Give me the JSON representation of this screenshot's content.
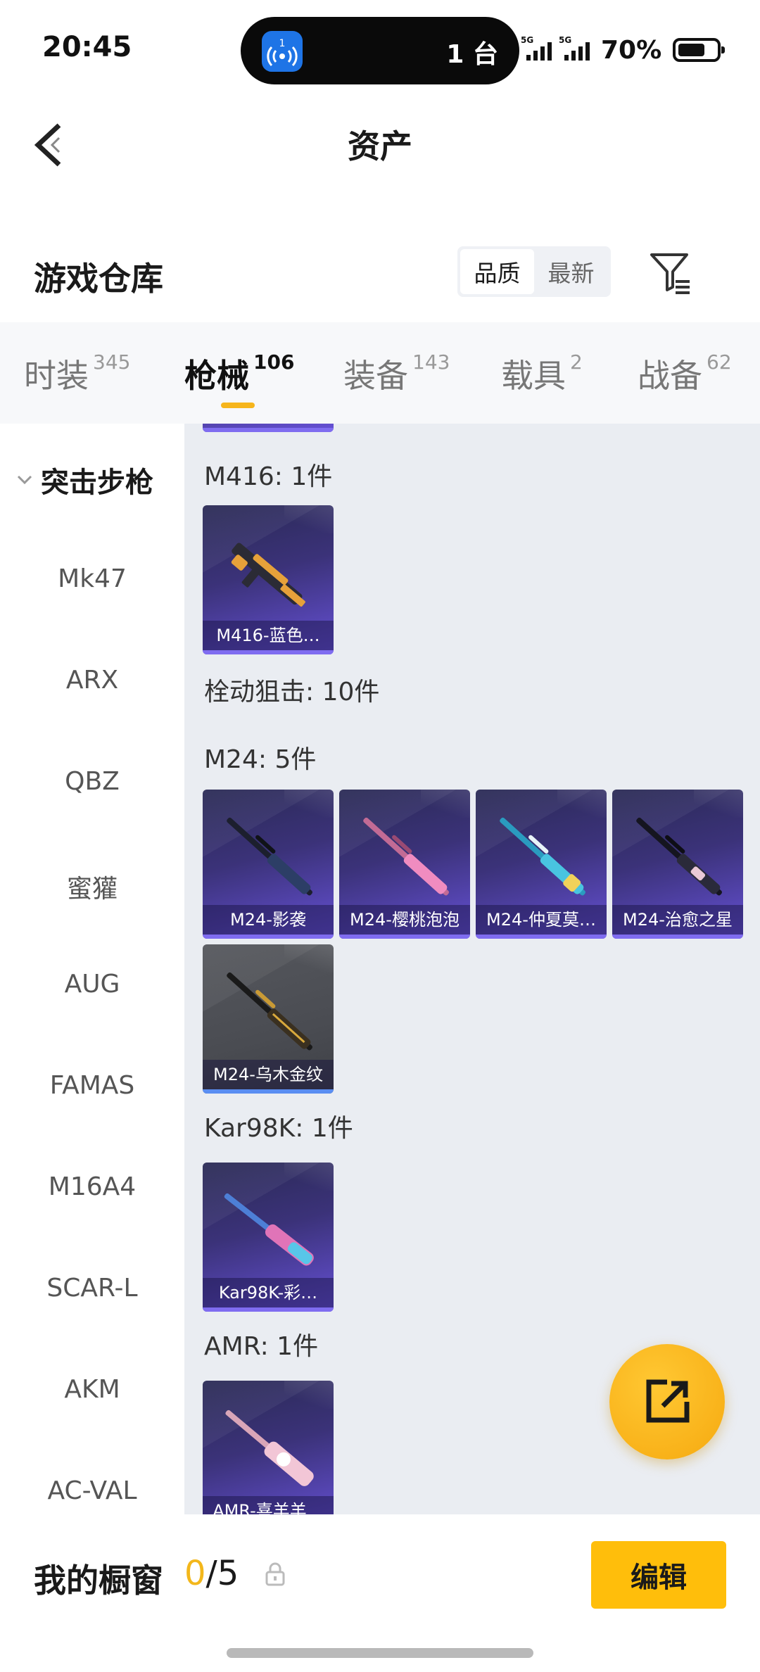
{
  "status": {
    "time": "20:45",
    "island_text": "1 台",
    "island_badge": "1",
    "sim1": "5G",
    "sim2": "5G",
    "battery_pct": "70%",
    "battery_level": 0.7
  },
  "nav": {
    "title": "资产"
  },
  "warehouse": {
    "title": "游戏仓库",
    "sort_options": [
      "品质",
      "最新"
    ],
    "sort_selected": "品质"
  },
  "tabs": [
    {
      "label": "时装",
      "count": "345"
    },
    {
      "label": "枪械",
      "count": "106",
      "active": true
    },
    {
      "label": "装备",
      "count": "143"
    },
    {
      "label": "载具",
      "count": "2"
    },
    {
      "label": "战备",
      "count": "62"
    }
  ],
  "sidebar": {
    "group": "突击步枪",
    "items": [
      "Mk47",
      "ARX",
      "QBZ",
      "蜜獾",
      "AUG",
      "FAMAS",
      "M16A4",
      "SCAR-L",
      "AKM",
      "AC-VAL"
    ]
  },
  "content": {
    "sections": [
      {
        "label": "M416: 1件",
        "cards": [
          {
            "name": "M416-蓝色…",
            "quality": "purple",
            "gun_color": "#e6a13a"
          }
        ]
      },
      {
        "label": "栓动狙击: 10件",
        "cards": []
      },
      {
        "label": "M24: 5件",
        "cards": [
          {
            "name": "M24-影袭",
            "quality": "purple",
            "gun_color": "#2c3e66"
          },
          {
            "name": "M24-樱桃泡泡",
            "quality": "purple",
            "gun_color": "#f08cc0"
          },
          {
            "name": "M24-仲夏莫…",
            "quality": "purple",
            "gun_color": "#49c4e0"
          },
          {
            "name": "M24-治愈之星",
            "quality": "purple",
            "gun_color": "#2a2a3a"
          },
          {
            "name": "M24-乌木金纹",
            "quality": "grey",
            "gun_color": "#3a3020"
          }
        ]
      },
      {
        "label": "Kar98K: 1件",
        "cards": [
          {
            "name": "Kar98K-彩…",
            "quality": "purple",
            "gun_color": "#e074b8"
          }
        ]
      },
      {
        "label": "AMR: 1件",
        "cards": [
          {
            "name": "AMR-喜羊羊…",
            "quality": "purple",
            "gun_color": "#f2c6d6"
          }
        ]
      }
    ]
  },
  "bottom": {
    "window_label": "我的橱窗",
    "window_current": "0",
    "window_total": "/5",
    "edit_label": "编辑"
  },
  "colors": {
    "accent": "#ffbe0b",
    "card_purple": "#6651d6",
    "tab_indicator": "#f6b51c"
  }
}
